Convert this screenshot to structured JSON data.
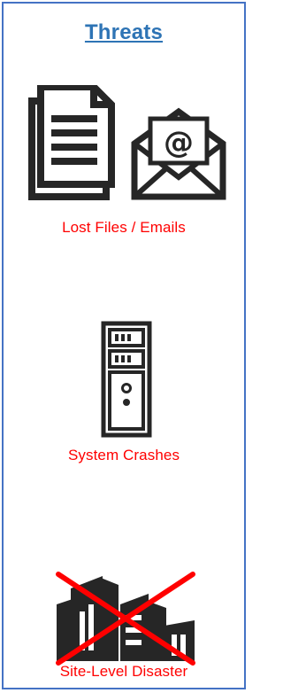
{
  "panel": {
    "title": "Threats"
  },
  "threats": [
    {
      "label": "Lost Files / Emails",
      "icons": [
        "document-icon",
        "email-envelope-icon"
      ]
    },
    {
      "label": "System Crashes",
      "icons": [
        "server-tower-icon"
      ]
    },
    {
      "label": "Site-Level Disaster",
      "icons": [
        "building-icon",
        "red-x-icon"
      ]
    }
  ],
  "colors": {
    "border": "#4472c4",
    "title": "#2e74b5",
    "threat_label": "#ff0000",
    "icon": "#262626"
  }
}
